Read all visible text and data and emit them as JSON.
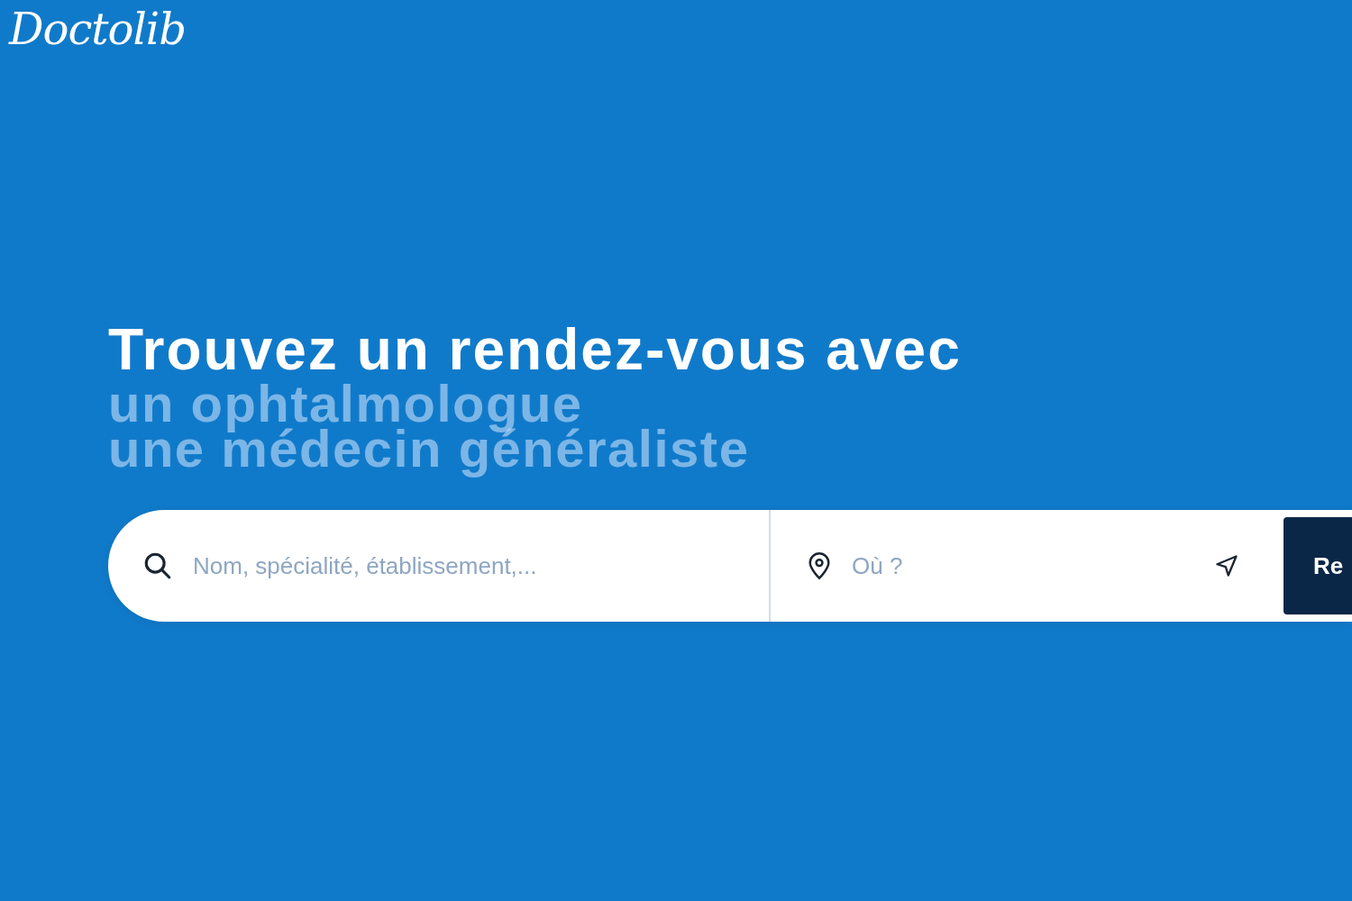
{
  "logo": {
    "text": "Doctolib"
  },
  "headline": {
    "title": "Trouvez un rendez-vous avec",
    "rotating_lines": [
      "un ophtalmologue",
      "une médecin généraliste"
    ]
  },
  "search": {
    "query": {
      "placeholder": "Nom, spécialité, établissement,..."
    },
    "location": {
      "placeholder": "Où ?"
    },
    "button": "Re"
  }
}
